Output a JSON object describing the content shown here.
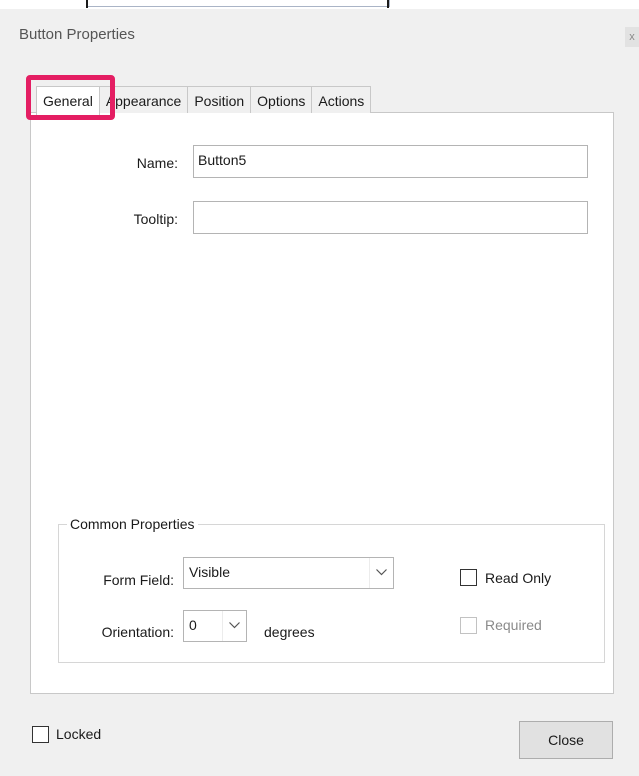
{
  "dialog": {
    "title": "Button Properties"
  },
  "tabs": [
    {
      "label": "General",
      "active": true
    },
    {
      "label": "Appearance",
      "active": false
    },
    {
      "label": "Position",
      "active": false
    },
    {
      "label": "Options",
      "active": false
    },
    {
      "label": "Actions",
      "active": false
    }
  ],
  "general": {
    "name_label": "Name:",
    "name_value": "Button5",
    "tooltip_label": "Tooltip:",
    "tooltip_value": ""
  },
  "common_properties": {
    "legend": "Common Properties",
    "form_field_label": "Form Field:",
    "form_field_value": "Visible",
    "orientation_label": "Orientation:",
    "orientation_value": "0",
    "degrees_label": "degrees",
    "read_only": {
      "label": "Read Only",
      "checked": false
    },
    "required": {
      "label": "Required",
      "checked": false,
      "disabled": true
    }
  },
  "footer": {
    "locked_label": "Locked",
    "locked_checked": false,
    "close_label": "Close"
  },
  "icons": {
    "dropdown": "chevron-down-icon"
  },
  "colors": {
    "highlight": "#e41e63"
  }
}
